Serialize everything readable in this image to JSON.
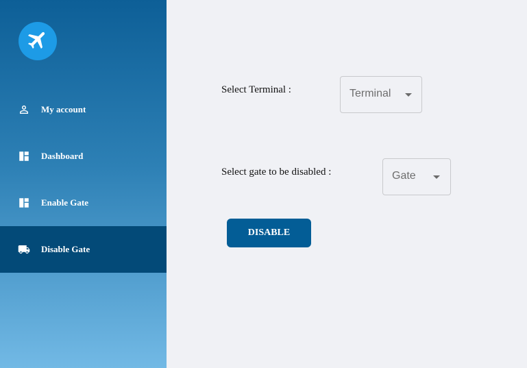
{
  "sidebar": {
    "logo_icon": "airplane-icon",
    "items": [
      {
        "label": "My account",
        "icon": "person-icon",
        "active": false
      },
      {
        "label": "Dashboard",
        "icon": "dashboard-icon",
        "active": false
      },
      {
        "label": "Enable Gate",
        "icon": "dashboard-icon",
        "active": false
      },
      {
        "label": "Disable Gate",
        "icon": "truck-icon",
        "active": true
      }
    ]
  },
  "form": {
    "terminal_label": "Select Terminal :",
    "terminal_value": "Terminal",
    "gate_label": "Select gate to be disabled :",
    "gate_value": "Gate",
    "disable_button": "DISABLE"
  },
  "colors": {
    "sidebar_top": "#0d5f97",
    "sidebar_bottom": "#72b9e5",
    "active_item": "#034a78",
    "button": "#035d96",
    "logo": "#1d9be6",
    "background": "#f0f1f5"
  }
}
